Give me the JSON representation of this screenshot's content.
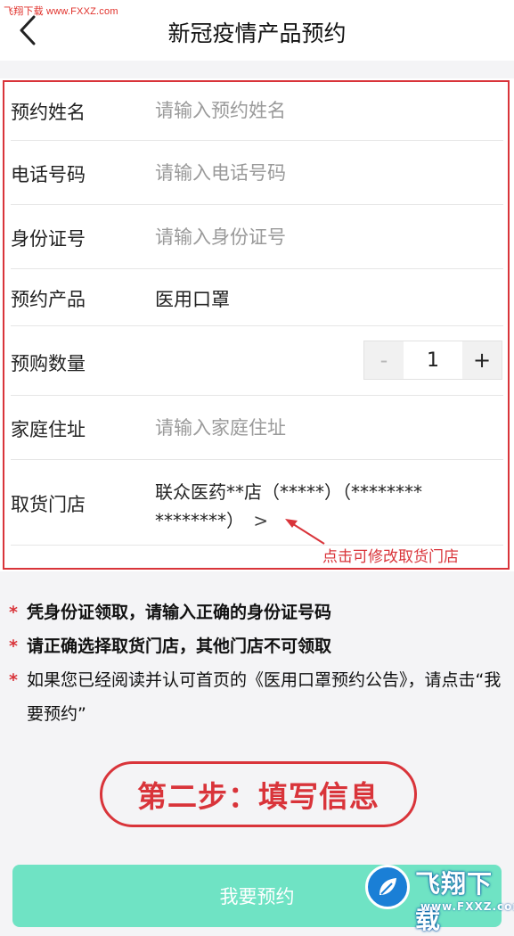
{
  "watermark_top": "飞翔下载 www.FXXZ.com",
  "header": {
    "title": "新冠疫情产品预约"
  },
  "form": {
    "name": {
      "label": "预约姓名",
      "placeholder": "请输入预约姓名"
    },
    "phone": {
      "label": "电话号码",
      "placeholder": "请输入电话号码"
    },
    "id_card": {
      "label": "身份证号",
      "placeholder": "请输入身份证号"
    },
    "product": {
      "label": "预约产品",
      "value": "医用口罩"
    },
    "quantity": {
      "label": "预购数量",
      "minus": "-",
      "value": "1",
      "plus": "+"
    },
    "address": {
      "label": "家庭住址",
      "placeholder": "请输入家庭住址"
    },
    "store": {
      "label": "取货门店",
      "line1": "联众医药**店（*****）（********",
      "line2": "********）",
      "chevron": ">"
    }
  },
  "annotation": "点击可修改取货门店",
  "notes": [
    {
      "star": "*",
      "text": "凭身份证领取，请输入正确的身份证号码",
      "bold": true
    },
    {
      "star": "*",
      "text": "请正确选择取货门店，其他门店不可领取",
      "bold": true
    },
    {
      "star": "*",
      "text": "如果您已经阅读并认可首页的《医用口罩预约公告》，请点击“我要预约”",
      "bold": false
    }
  ],
  "step_badge": "第二步：填写信息",
  "submit_label": "我要预约",
  "watermark_logo": {
    "text": "飞翔下载",
    "url": "www.FXXZ.com"
  },
  "colors": {
    "accent_red": "#d9343a",
    "button_teal": "#6fe3c4",
    "logo_blue": "#1a7fd6"
  }
}
